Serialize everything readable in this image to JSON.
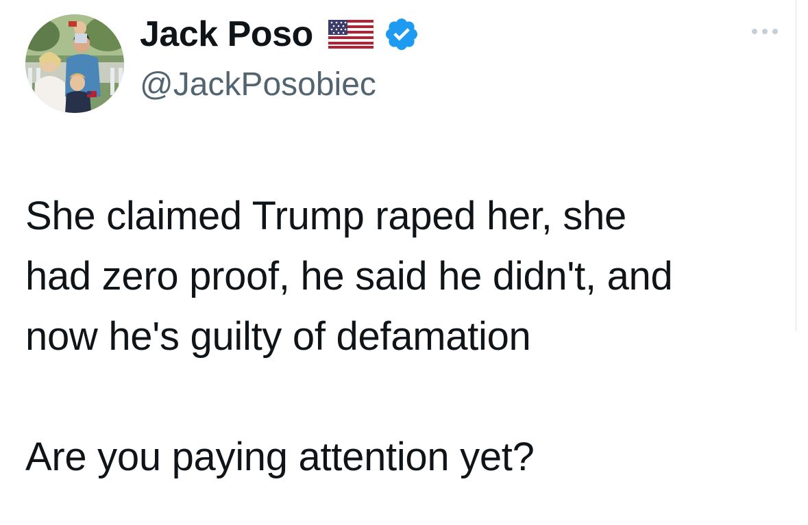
{
  "author": {
    "display_name": "Jack Poso",
    "handle": "@JackPosobiec",
    "flag_icon": "us-flag-icon",
    "verified_icon": "verified-badge-icon",
    "verified_color": "#1d9bf0"
  },
  "menu": {
    "more_icon": "more-options-icon"
  },
  "tweet": {
    "paragraphs": [
      "She claimed Trump raped her, she\nhad zero proof, he said he didn't, and\nnow he's guilty of defamation",
      "Are you paying attention yet?"
    ]
  },
  "colors": {
    "text_primary": "#0f1419",
    "text_secondary": "#536471",
    "accent": "#1d9bf0"
  }
}
